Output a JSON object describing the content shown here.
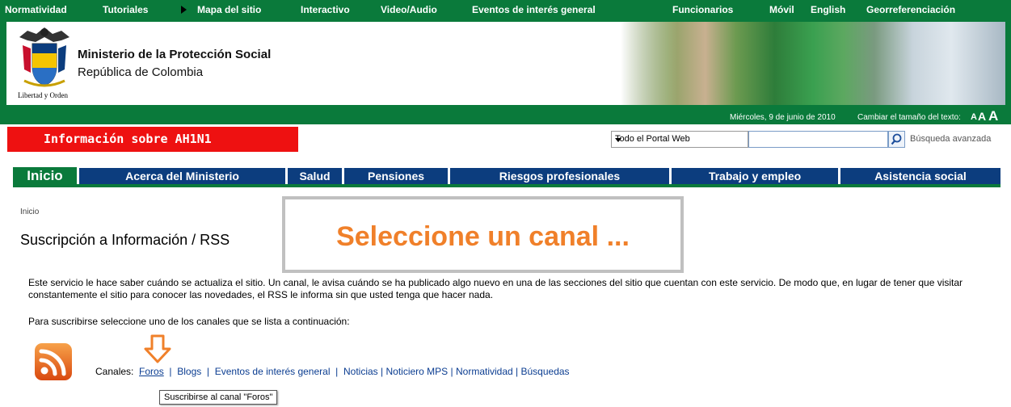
{
  "topbar": {
    "links": [
      {
        "id": "normatividad",
        "label": "Normatividad"
      },
      {
        "id": "tutoriales",
        "label": "Tutoriales"
      },
      {
        "id": "mapa",
        "label": "Mapa del sitio"
      },
      {
        "id": "interactivo",
        "label": "Interactivo"
      },
      {
        "id": "video",
        "label": "Video/Audio"
      },
      {
        "id": "eventos",
        "label": "Eventos de interés general"
      },
      {
        "id": "funcionarios",
        "label": "Funcionarios"
      },
      {
        "id": "movil",
        "label": "Móvil"
      },
      {
        "id": "english",
        "label": "English"
      },
      {
        "id": "georef",
        "label": "Georreferenciación"
      }
    ]
  },
  "header": {
    "org_name": "Ministerio de la Protección Social",
    "country": "República de Colombia",
    "crest_caption": "Libertad y Orden"
  },
  "datebar": {
    "date": "Miércoles, 9 de junio de 2010",
    "resize_label": "Cambiar el tamaño del texto:",
    "sizes": [
      "A",
      "A",
      "A"
    ]
  },
  "alert": {
    "label": "Información sobre AH1N1"
  },
  "search": {
    "scope": "Todo el Portal Web",
    "value": "",
    "advanced": "Búsqueda avanzada"
  },
  "nav": {
    "items": [
      {
        "id": "inicio",
        "label": "Inicio"
      },
      {
        "id": "acerca",
        "label": "Acerca del Ministerio"
      },
      {
        "id": "salud",
        "label": "Salud"
      },
      {
        "id": "pensiones",
        "label": "Pensiones"
      },
      {
        "id": "riesgos",
        "label": "Riesgos profesionales"
      },
      {
        "id": "trabajo",
        "label": "Trabajo y empleo"
      },
      {
        "id": "asistencia",
        "label": "Asistencia social"
      }
    ]
  },
  "content": {
    "breadcrumb": "Inicio",
    "title": "Suscripción a Información / RSS",
    "callout": "Seleccione un canal ...",
    "intro": "Este servicio le hace saber cuándo se actualiza el sitio. Un canal, le avisa cuándo se ha publicado algo nuevo en una de las secciones del sitio que cuentan con este servicio. De modo que, en lugar de tener que visitar constantemente el sitio para conocer las novedades, el RSS le informa sin que usted tenga que hacer nada.",
    "instruction": "Para suscribirse seleccione uno de los canales que se lista a continuación:",
    "channels_label": "Canales:",
    "channels": [
      "Foros",
      "Blogs",
      "Eventos de interés general",
      "Noticias",
      "Noticiero MPS",
      "Normatividad",
      "Búsquedas"
    ],
    "tooltip": "Suscribirse al canal \"Foros\""
  },
  "colors": {
    "brand_green": "#0a7a3b",
    "nav_blue": "#0c3d7e",
    "alert_red": "#ee1111",
    "callout_orange": "#f0802a",
    "link_blue": "#0b3d91"
  }
}
